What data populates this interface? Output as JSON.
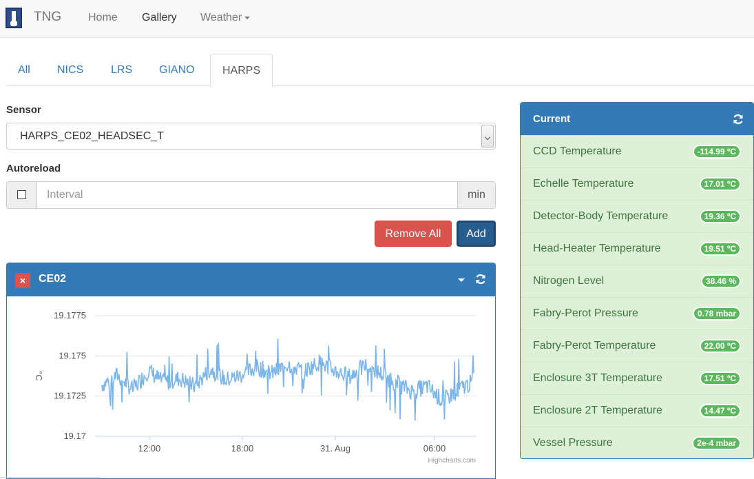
{
  "navbar": {
    "brand": "TNG",
    "items": [
      {
        "label": "Home"
      },
      {
        "label": "Gallery"
      },
      {
        "label": "Weather"
      }
    ]
  },
  "tabs": [
    {
      "label": "All"
    },
    {
      "label": "NICS"
    },
    {
      "label": "LRS"
    },
    {
      "label": "GIANO"
    },
    {
      "label": "HARPS"
    }
  ],
  "form": {
    "sensor_label": "Sensor",
    "sensor_value": "HARPS_CE02_HEADSEC_T",
    "autoreload_label": "Autoreload",
    "interval_placeholder": "Interval",
    "interval_unit": "min",
    "remove_all_label": "Remove All",
    "add_label": "Add"
  },
  "chart_panel": {
    "title": "CE02",
    "close_glyph": "×"
  },
  "chart_data": {
    "type": "line",
    "title": "",
    "ylabel": "°C",
    "ylim": [
      19.17,
      19.1775
    ],
    "y_ticks": [
      "19.1775",
      "19.175",
      "19.1725",
      "19.17"
    ],
    "x_ticks": [
      "12:00",
      "18:00",
      "31. Aug",
      "06:00"
    ],
    "credit": "Highcharts.com",
    "series": [
      {
        "values": [
          19.1732,
          19.1738,
          19.1729,
          19.1741,
          19.1733,
          19.1736,
          19.1731,
          19.1742,
          19.1735,
          19.1738,
          19.1743,
          19.1739,
          19.1745,
          19.174,
          19.1746,
          19.1741,
          19.1737,
          19.1744,
          19.1739,
          19.1733,
          19.1728,
          19.1731,
          19.1722,
          19.1729,
          19.1734
        ]
      }
    ],
    "color": "#7cb5ec"
  },
  "current": {
    "title": "Current",
    "rows": [
      {
        "label": "CCD Temperature",
        "value": "-114.99 ºC"
      },
      {
        "label": "Echelle Temperature",
        "value": "17.01 ºC"
      },
      {
        "label": "Detector-Body Temperature",
        "value": "19.36 ºC"
      },
      {
        "label": "Head-Heater Temperature",
        "value": "19.51 ºC"
      },
      {
        "label": "Nitrogen Level",
        "value": "38.46 %"
      },
      {
        "label": "Fabry-Perot Pressure",
        "value": "0.78 mbar"
      },
      {
        "label": "Fabry-Perot Temperature",
        "value": "22.00 ºC"
      },
      {
        "label": "Enclosure 3T Temperature",
        "value": "17.51 ºC"
      },
      {
        "label": "Enclosure 2T Temperature",
        "value": "14.47 ºC"
      },
      {
        "label": "Vessel Pressure",
        "value": "2e-4 mbar"
      }
    ]
  }
}
